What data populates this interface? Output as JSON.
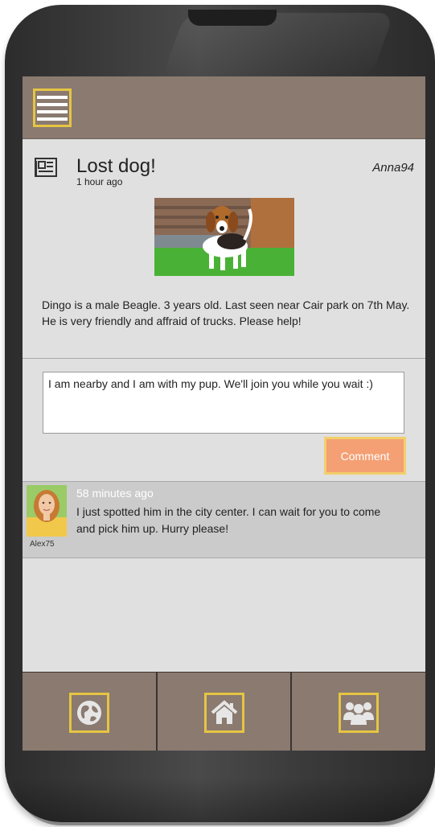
{
  "topbar": {
    "menu_icon": "hamburger-menu-icon"
  },
  "post": {
    "icon": "newspaper-icon",
    "title": "Lost dog!",
    "time": "1 hour ago",
    "author": "Anna94",
    "body": "Dingo is a male Beagle. 3 years old. Last seen near Cair park on 7th May. He is very friendly and affraid of trucks. Please help!"
  },
  "comment_form": {
    "value": "I am nearby and I am with my pup. We'll join you while you wait :)",
    "button_label": "Comment"
  },
  "comments": [
    {
      "user": "Alex75",
      "time": "58 minutes ago",
      "text": "I just spotted him in the city center. I can wait for you to come and pick him up. Hurry please!"
    }
  ],
  "bottom_nav": [
    {
      "icon": "globe-icon"
    },
    {
      "icon": "home-icon"
    },
    {
      "icon": "people-icon"
    }
  ],
  "colors": {
    "bar": "#8a7a70",
    "accent_border": "#e5c543",
    "comment_button": "#f4a074",
    "screen_bg": "#e0e0e0"
  }
}
